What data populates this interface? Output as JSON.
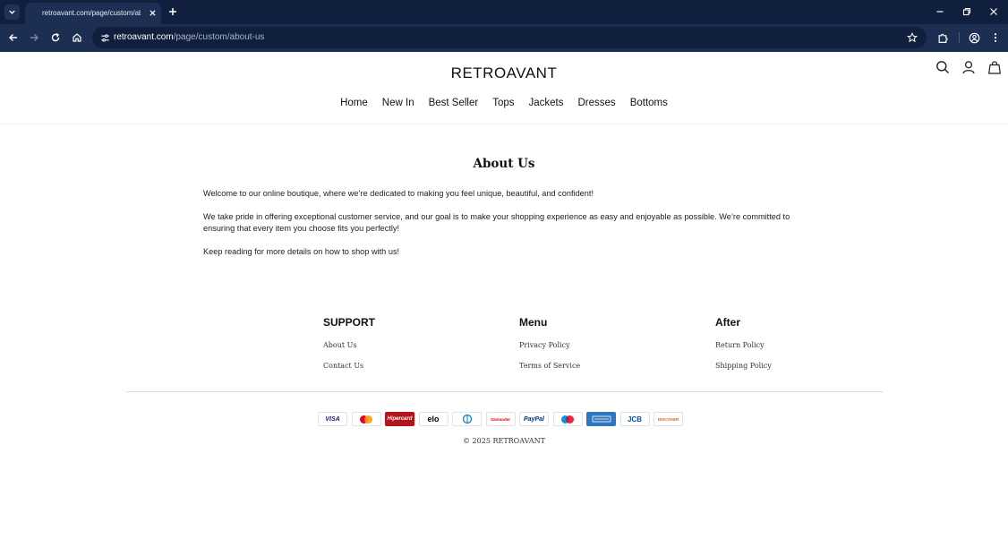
{
  "browser": {
    "tab_title": "retroavant.com/page/custom/about-us",
    "url_host": "retroavant.com",
    "url_path": "/page/custom/about-us",
    "colors": {
      "tabbar": "#0f1f3d",
      "toolbar": "#1c2e52"
    },
    "icons": [
      "chevron-down-icon",
      "close-icon",
      "plus-icon",
      "minimize-icon",
      "restore-icon",
      "back-icon",
      "forward-icon",
      "reload-icon",
      "home-icon",
      "site-info-icon",
      "star-icon",
      "extensions-icon",
      "profile-icon",
      "more-icon"
    ]
  },
  "site": {
    "brand": "RETROAVANT",
    "nav": [
      {
        "label": "Home"
      },
      {
        "label": "New In"
      },
      {
        "label": "Best Seller"
      },
      {
        "label": "Tops"
      },
      {
        "label": "Jackets"
      },
      {
        "label": "Dresses"
      },
      {
        "label": "Bottoms"
      }
    ],
    "header_icons": [
      "search-icon",
      "account-icon",
      "bag-icon"
    ]
  },
  "main": {
    "title": "About Us",
    "paragraphs": [
      "Welcome to our online boutique, where we’re dedicated to making you feel unique, beautiful, and confident!",
      "We take pride in offering exceptional customer service, and our goal is to make your shopping experience as easy and enjoyable as possible. We’re committed to ensuring that every item you choose fits you perfectly!",
      "Keep reading for more details on how to shop with us!"
    ]
  },
  "footer": {
    "columns": [
      {
        "heading": "SUPPORT",
        "links": [
          "About Us",
          "Contact Us"
        ]
      },
      {
        "heading": "Menu",
        "links": [
          "Privacy Policy",
          "Terms of Service"
        ]
      },
      {
        "heading": "After",
        "links": [
          "Return Policy",
          "Shipping Policy"
        ]
      }
    ],
    "payments": [
      {
        "name": "visa-logo",
        "label": "VISA",
        "color": "#1a1f71"
      },
      {
        "name": "mastercard-logo",
        "label": "",
        "color": "#eb001b"
      },
      {
        "name": "hipercard-logo",
        "label": "Hipercard",
        "color": "#b3131b"
      },
      {
        "name": "elo-logo",
        "label": "elo",
        "color": "#000000"
      },
      {
        "name": "diners-club-logo",
        "label": "",
        "color": "#0079be"
      },
      {
        "name": "santander-logo",
        "label": "Santander",
        "color": "#ec0000"
      },
      {
        "name": "paypal-logo",
        "label": "PayPal",
        "color": "#003087"
      },
      {
        "name": "maestro-logo",
        "label": "",
        "color": "#0099df"
      },
      {
        "name": "amex-logo",
        "label": "",
        "color": "#2e77bc"
      },
      {
        "name": "jcb-logo",
        "label": "JCB",
        "color": "#0b4ea2"
      },
      {
        "name": "discover-logo",
        "label": "DISCOVER",
        "color": "#e55c20"
      }
    ],
    "copyright": "© 2025 RETROAVANT"
  }
}
